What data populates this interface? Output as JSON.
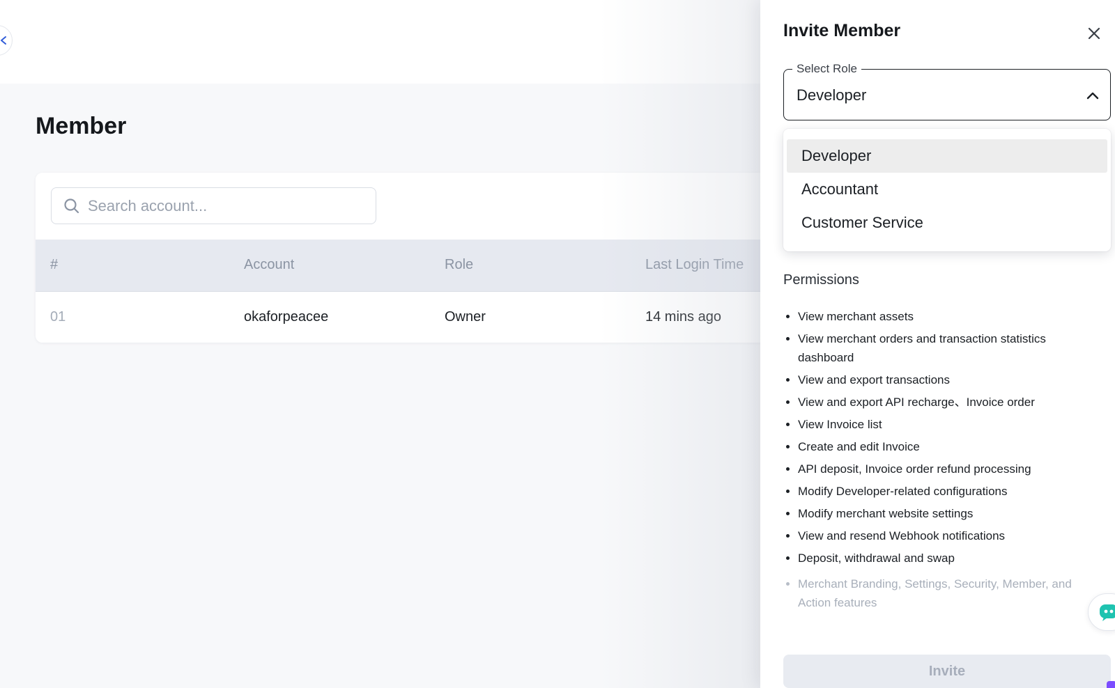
{
  "page": {
    "title": "Member"
  },
  "search": {
    "placeholder": "Search account..."
  },
  "table": {
    "headers": {
      "index": "#",
      "account": "Account",
      "role": "Role",
      "last_login": "Last Login Time"
    },
    "rows": [
      {
        "index": "01",
        "account": "okaforpeacee",
        "role": "Owner",
        "last_login": "14 mins ago"
      }
    ]
  },
  "drawer": {
    "title": "Invite Member",
    "select_role": {
      "label": "Select Role",
      "value": "Developer",
      "options": [
        "Developer",
        "Accountant",
        "Customer Service"
      ]
    },
    "permissions_title": "Permissions",
    "permissions": [
      "View merchant assets",
      "View merchant orders and transaction statistics dashboard",
      "View and export transactions",
      "View and export API recharge、Invoice order",
      "View Invoice list",
      "Create and edit Invoice",
      "API deposit, Invoice order refund processing",
      "Modify Developer-related configurations",
      "Modify merchant website settings",
      "View and resend Webhook notifications",
      "Deposit, withdrawal and swap"
    ],
    "disabled_permission": "Merchant Branding, Settings, Security, Member, and Action features",
    "invite_label": "Invite"
  },
  "colors": {
    "accent": "#2f5bd8",
    "chat": "#1fc3b0",
    "widget_purple": "#7b4cff"
  },
  "icons": [
    "back-icon",
    "search-icon",
    "close-icon",
    "chevron-up-icon",
    "chat-bot-icon"
  ]
}
